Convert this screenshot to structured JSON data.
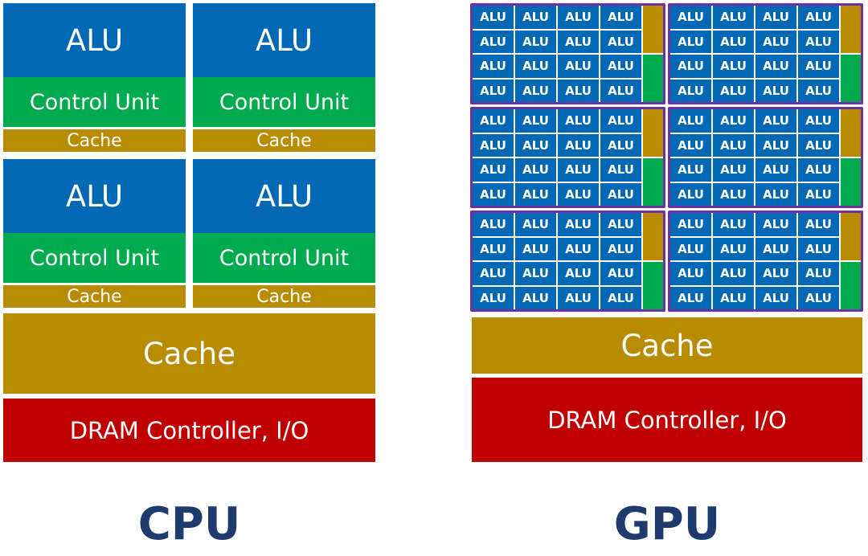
{
  "colors": {
    "alu": "#0068b5",
    "control_unit": "#00aa4f",
    "cache": "#b88b00",
    "dram": "#c00000",
    "sm_border": "#7030a0",
    "title": "#1f3b6e"
  },
  "cpu": {
    "title": "CPU",
    "cores": [
      {
        "alu": "ALU",
        "control_unit": "Control Unit",
        "cache": "Cache"
      },
      {
        "alu": "ALU",
        "control_unit": "Control Unit",
        "cache": "Cache"
      },
      {
        "alu": "ALU",
        "control_unit": "Control Unit",
        "cache": "Cache"
      },
      {
        "alu": "ALU",
        "control_unit": "Control Unit",
        "cache": "Cache"
      }
    ],
    "shared_cache": "Cache",
    "dram": "DRAM Controller,  I/O"
  },
  "gpu": {
    "title": "GPU",
    "sm_count": 6,
    "alus_per_sm": 16,
    "alu_label": "ALU",
    "shared_cache": "Cache",
    "dram": "DRAM Controller,  I/O"
  }
}
